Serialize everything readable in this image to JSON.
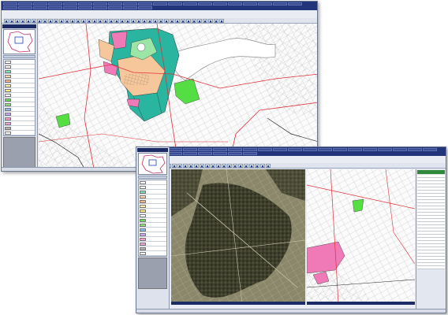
{
  "window1": {
    "menu_items": [
      "",
      "",
      "",
      "",
      "",
      "",
      "",
      "",
      "",
      "",
      "",
      "",
      "",
      "",
      "",
      "",
      "",
      "",
      "",
      "",
      "",
      "",
      "",
      "",
      "",
      "",
      "",
      "",
      "",
      ""
    ],
    "side_title": "",
    "legend_header": "",
    "legend": [
      {
        "label": "",
        "color": "#ffffff"
      },
      {
        "label": "",
        "color": "#ffffff"
      },
      {
        "label": "",
        "color": "#7de0b0"
      },
      {
        "label": "",
        "color": "#ffd6b0"
      },
      {
        "label": "",
        "color": "#f5b08a"
      },
      {
        "label": "",
        "color": "#fff2a8"
      },
      {
        "label": "",
        "color": "#ffe680"
      },
      {
        "label": "",
        "color": "#ffffff"
      },
      {
        "label": "",
        "color": "#66dd55"
      },
      {
        "label": "",
        "color": "#8be07a"
      },
      {
        "label": "",
        "color": "#88bbee"
      },
      {
        "label": "",
        "color": "#c9a7f0"
      },
      {
        "label": "",
        "color": "#ff99cc"
      },
      {
        "label": "",
        "color": "#f0a0d8"
      },
      {
        "label": "",
        "color": "#b0b0b0"
      },
      {
        "label": "",
        "color": "#ffffff"
      }
    ],
    "status_items": [
      "",
      ""
    ]
  },
  "window2": {
    "menu_items": [
      "",
      "",
      "",
      "",
      "",
      "",
      "",
      "",
      "",
      "",
      "",
      "",
      "",
      "",
      "",
      "",
      "",
      "",
      "",
      "",
      "",
      "",
      "",
      "",
      "",
      "",
      "",
      ""
    ],
    "side_title": "",
    "legend_header": "",
    "legend": [
      {
        "label": "",
        "color": "#ffffff"
      },
      {
        "label": "",
        "color": "#ffffff"
      },
      {
        "label": "",
        "color": "#7de0b0"
      },
      {
        "label": "",
        "color": "#ffd6b0"
      },
      {
        "label": "",
        "color": "#f5b08a"
      },
      {
        "label": "",
        "color": "#fff2a8"
      },
      {
        "label": "",
        "color": "#ffe680"
      },
      {
        "label": "",
        "color": "#ffffff"
      },
      {
        "label": "",
        "color": "#66dd55"
      },
      {
        "label": "",
        "color": "#8be07a"
      },
      {
        "label": "",
        "color": "#88bbee"
      },
      {
        "label": "",
        "color": "#c9a7f0"
      },
      {
        "label": "",
        "color": "#ff99cc"
      },
      {
        "label": "",
        "color": "#f0a0d8"
      },
      {
        "label": "",
        "color": "#b0b0b0"
      },
      {
        "label": "",
        "color": "#ffffff"
      }
    ],
    "left_pane_title": "",
    "right_pane_title": "",
    "right_panel_header": "",
    "status_items": [
      "",
      ""
    ]
  },
  "colors": {
    "title_bar": "#23357a",
    "teal_zone": "#2ab5a0",
    "pink_zone": "#f07ab8",
    "orange_zone": "#f7c79c",
    "green_zone": "#55dd44",
    "road_red": "#e0303a"
  }
}
